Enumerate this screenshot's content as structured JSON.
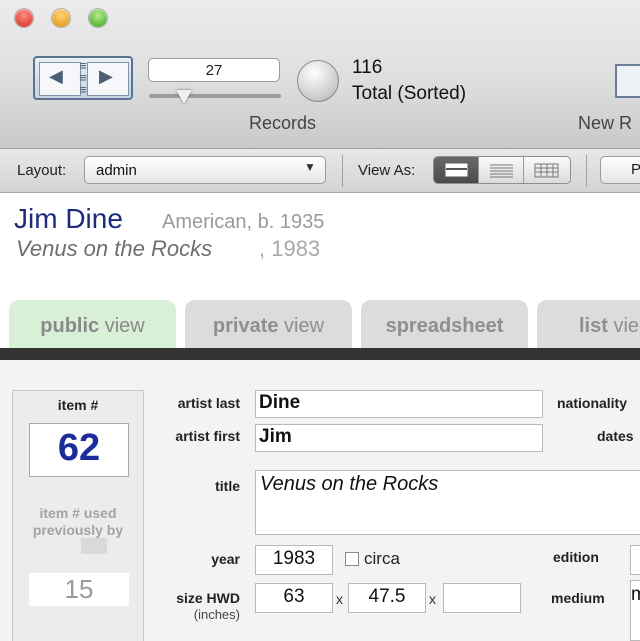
{
  "toolbar": {
    "record_number": "27",
    "total_count": "116",
    "total_label": "Total (Sorted)",
    "records_label": "Records",
    "new_record_label": "New R"
  },
  "layout_bar": {
    "layout_label": "Layout:",
    "layout_value": "admin",
    "view_as_label": "View As:",
    "p_button": "P"
  },
  "header": {
    "artist_name": "Jim Dine",
    "artist_meta": "American, b. 1935",
    "artwork_title": "Venus on the Rocks",
    "artwork_year": ", 1983"
  },
  "tabs": [
    {
      "bold": "public",
      "light": " view"
    },
    {
      "bold": "private",
      "light": " view"
    },
    {
      "bold": "spreadsheet",
      "light": ""
    },
    {
      "bold": "list",
      "light": " vie"
    }
  ],
  "record": {
    "item_label": "item #",
    "item_value": "62",
    "prev_label": "item # used previously by",
    "prev_value": "15",
    "artist_last_label": "artist last",
    "artist_last": "Dine",
    "artist_first_label": "artist first",
    "artist_first": "Jim",
    "nationality_label": "nationality",
    "dates_label": "dates",
    "title_label": "title",
    "title": "Venus on the Rocks",
    "year_label": "year",
    "year": "1983",
    "circa_label": "circa",
    "edition_label": "edition",
    "size_label": "size HWD",
    "size_units": "(inches)",
    "height": "63",
    "width": "47.5",
    "depth": "",
    "x_sep": "x",
    "medium_label": "medium",
    "medium": "m"
  },
  "colors": {
    "artist_name": "#1e2b7c",
    "item_number": "#1d2c9b",
    "active_tab": "#d8f1d6",
    "tab_bar": "#333333"
  }
}
